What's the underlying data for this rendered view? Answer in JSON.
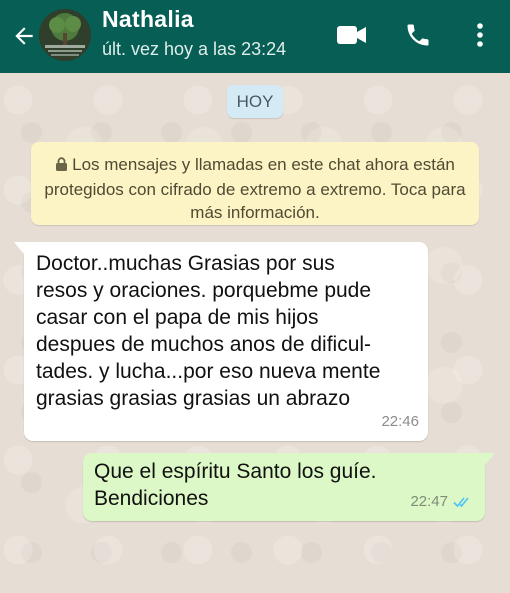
{
  "header": {
    "contact_name": "Nathalia",
    "status": "últ. vez hoy a las 23:24",
    "background_color": "#075e54"
  },
  "icons": {
    "back": "arrow-left-icon",
    "avatar": "tree-avatar",
    "video": "video-camera-icon",
    "call": "phone-icon",
    "menu": "more-vertical-icon",
    "lock": "lock-icon",
    "read_receipt": "double-check-icon"
  },
  "date_chip": "HOY",
  "encryption_notice": {
    "text": "Los mensajes y llamadas en este chat ahora están protegidos con cifrado de extremo a extremo. Toca para más información."
  },
  "messages": [
    {
      "direction": "incoming",
      "text": "Doctor..muchas Grasias por sus\nresos y oraciones. porquebme pude\ncasar con el papa de mis hijos\ndespues de muchos anos de dificul-\ntades. y lucha...por eso nueva mente\ngrasias grasias grasias un abrazo",
      "time": "22:46"
    },
    {
      "direction": "outgoing",
      "text": "Que el espíritu Santo los guíe.\nBendiciones",
      "time": "22:47",
      "read": true,
      "read_color": "#4fc3f7"
    }
  ],
  "colors": {
    "incoming_bubble": "#ffffff",
    "outgoing_bubble": "#dcf8c6",
    "notice_bg": "#fcf4c4",
    "date_chip_bg": "#d4eaf4"
  }
}
